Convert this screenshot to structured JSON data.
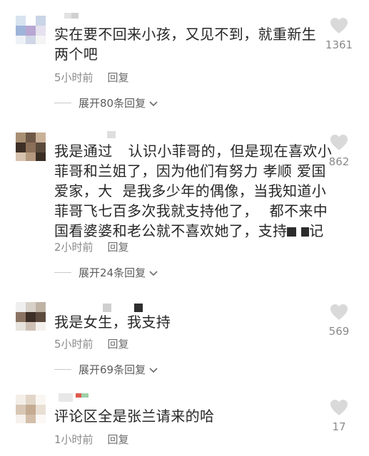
{
  "colors": {
    "text": "#262626",
    "meta": "#8a8a8a",
    "heart": "#d9d9d9"
  },
  "comments": [
    {
      "text": "实在要不回来小孩，又见不到，就重新生两个吧",
      "time": "5小时前",
      "reply": "回复",
      "expand": "展开80条回复",
      "likes": "1361"
    },
    {
      "text_parts": [
        "我是通过",
        "认识小菲哥的，但是现在喜欢小菲哥和兰姐了，因为他们有努力 孝顺 爱国爱家，大",
        "是我多少年的偶像，当我知道小菲哥飞七百多次我就支持他了，",
        "都不来中国看婆婆和老公就不喜欢她了，支持",
        "记"
      ],
      "time": "2小时前",
      "reply": "回复",
      "expand": "展开24条回复",
      "likes": "862"
    },
    {
      "text": "我是女生，我支持",
      "time": "5小时前",
      "reply": "回复",
      "expand": "展开69条回复",
      "likes": "569"
    },
    {
      "text": "评论区全是张兰请来的哈",
      "time": "1小时前",
      "reply": "回复",
      "likes": "17"
    }
  ],
  "icons": {
    "like": "heart-icon",
    "expand": "chevron-down-icon"
  }
}
